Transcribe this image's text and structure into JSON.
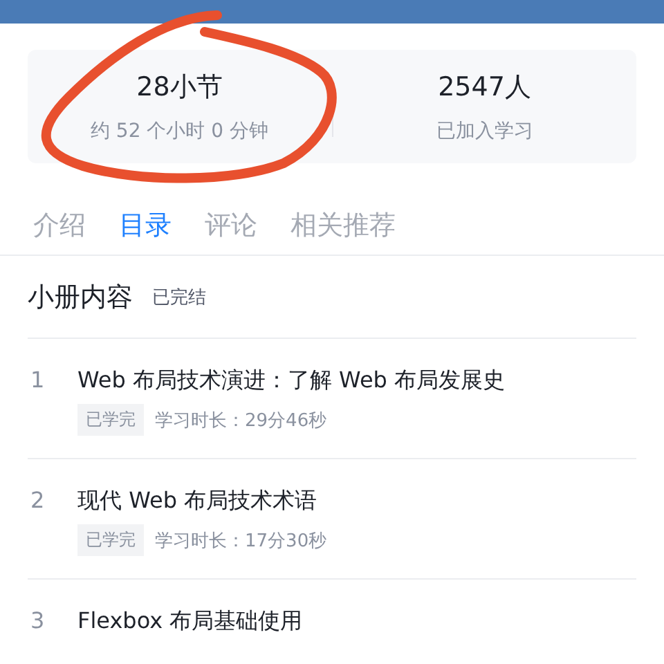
{
  "stats": [
    {
      "value": "28小节",
      "label": "约 52 个小时 0 分钟"
    },
    {
      "value": "2547人",
      "label": "已加入学习"
    }
  ],
  "tabs": [
    {
      "label": "介绍",
      "selected": false
    },
    {
      "label": "目录",
      "selected": true
    },
    {
      "label": "评论",
      "selected": false
    },
    {
      "label": "相关推荐",
      "selected": false
    }
  ],
  "section": {
    "title": "小册内容",
    "status": "已完结"
  },
  "chapters": [
    {
      "index": "1",
      "title": "Web 布局技术演进：了解 Web 布局发展史",
      "badge": "已学完",
      "meta": "学习时长：29分46秒"
    },
    {
      "index": "2",
      "title": "现代 Web 布局技术术语",
      "badge": "已学完",
      "meta": "学习时长：17分30秒"
    },
    {
      "index": "3",
      "title": "Flexbox 布局基础使用"
    }
  ]
}
